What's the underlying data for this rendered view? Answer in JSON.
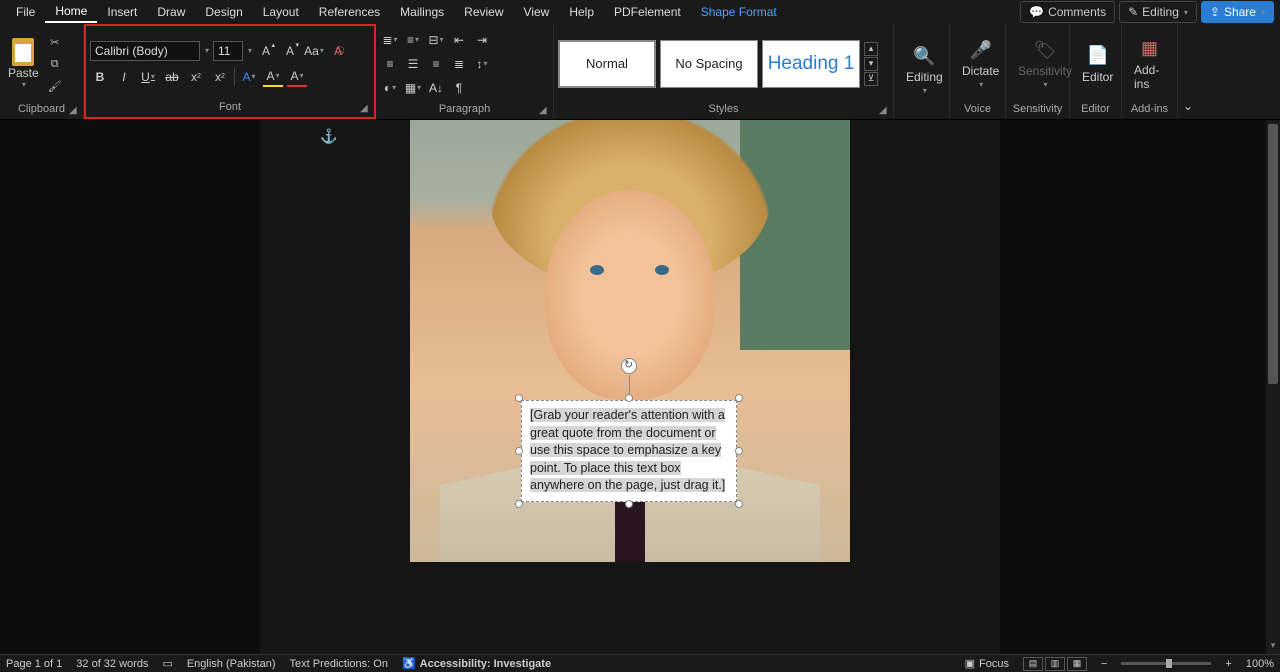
{
  "menu": {
    "file": "File",
    "home": "Home",
    "insert": "Insert",
    "draw": "Draw",
    "design": "Design",
    "layout": "Layout",
    "references": "References",
    "mailings": "Mailings",
    "review": "Review",
    "view": "View",
    "help": "Help",
    "pdfelement": "PDFelement",
    "shapeformat": "Shape Format",
    "comments": "Comments",
    "editing": "Editing",
    "share": "Share"
  },
  "ribbon": {
    "clipboard": {
      "label": "Clipboard",
      "paste": "Paste"
    },
    "font": {
      "label": "Font",
      "name": "Calibri (Body)",
      "size": "11",
      "bold": "B",
      "italic": "I",
      "underline": "U",
      "strike": "ab",
      "sub": "x",
      "sup": "x",
      "caseAa": "Aa",
      "clearA": "A",
      "textfillA": "A",
      "highlightA": "A",
      "fontcolorA": "A",
      "growA": "A",
      "shrinkA": "A"
    },
    "paragraph": {
      "label": "Paragraph"
    },
    "styles": {
      "label": "Styles",
      "normal": "Normal",
      "nospacing": "No Spacing",
      "heading1": "Heading 1"
    },
    "editing": {
      "label": "Editing"
    },
    "dictate": {
      "label": "Dictate"
    },
    "sensitivity": {
      "label": "Sensitivity"
    },
    "editor": {
      "label": "Editor"
    },
    "addins": {
      "label": "Add-ins"
    },
    "voice": "Voice",
    "sensG": "Sensitivity",
    "editorG": "Editor",
    "addinsG": "Add-ins"
  },
  "textbox": {
    "content": "[Grab your reader's attention with a great quote from the document or use this space to emphasize a key point. To place this text box anywhere on the page, just drag it.]"
  },
  "status": {
    "page": "Page 1 of 1",
    "words": "32 of 32 words",
    "lang": "English (Pakistan)",
    "pred": "Text Predictions: On",
    "access": "Accessibility: Investigate",
    "focus": "Focus",
    "zoom": "100%",
    "minus": "−",
    "plus": "+"
  }
}
